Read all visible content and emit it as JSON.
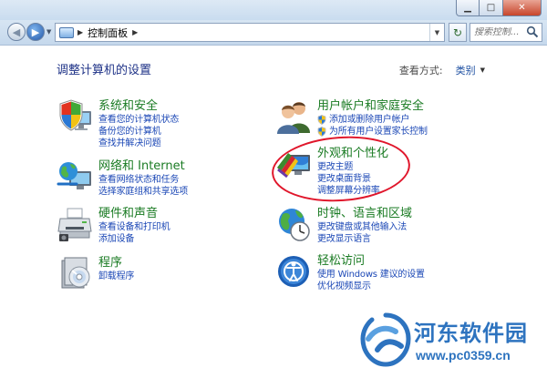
{
  "navigation": {
    "breadcrumb": [
      "控制面板"
    ],
    "search_placeholder": "搜索控制..."
  },
  "header": {
    "title": "调整计算机的设置",
    "view_by_label": "查看方式:",
    "view_by_value": "类别"
  },
  "categories": {
    "system": {
      "title": "系统和安全",
      "links": [
        "查看您的计算机状态",
        "备份您的计算机",
        "查找并解决问题"
      ]
    },
    "network": {
      "title": "网络和 Internet",
      "links": [
        "查看网络状态和任务",
        "选择家庭组和共享选项"
      ]
    },
    "hardware": {
      "title": "硬件和声音",
      "links": [
        "查看设备和打印机",
        "添加设备"
      ]
    },
    "programs": {
      "title": "程序",
      "links": [
        "卸载程序"
      ]
    },
    "users": {
      "title": "用户帐户和家庭安全",
      "links": [
        "添加或删除用户帐户",
        "为所有用户设置家长控制"
      ]
    },
    "appearance": {
      "title": "外观和个性化",
      "links": [
        "更改主题",
        "更改桌面背景",
        "调整屏幕分辨率"
      ]
    },
    "clock": {
      "title": "时钟、语言和区域",
      "links": [
        "更改键盘或其他输入法",
        "更改显示语言"
      ]
    },
    "ease": {
      "title": "轻松访问",
      "links": [
        "使用 Windows 建议的设置",
        "优化视频显示"
      ]
    }
  },
  "watermark": {
    "title": "河东软件园",
    "url": "www.pc0359.cn"
  },
  "colors": {
    "title_blue": "#1e3287",
    "category_green": "#1a7b23",
    "link_blue": "#1c48b6",
    "highlight_red": "#e0162b"
  }
}
